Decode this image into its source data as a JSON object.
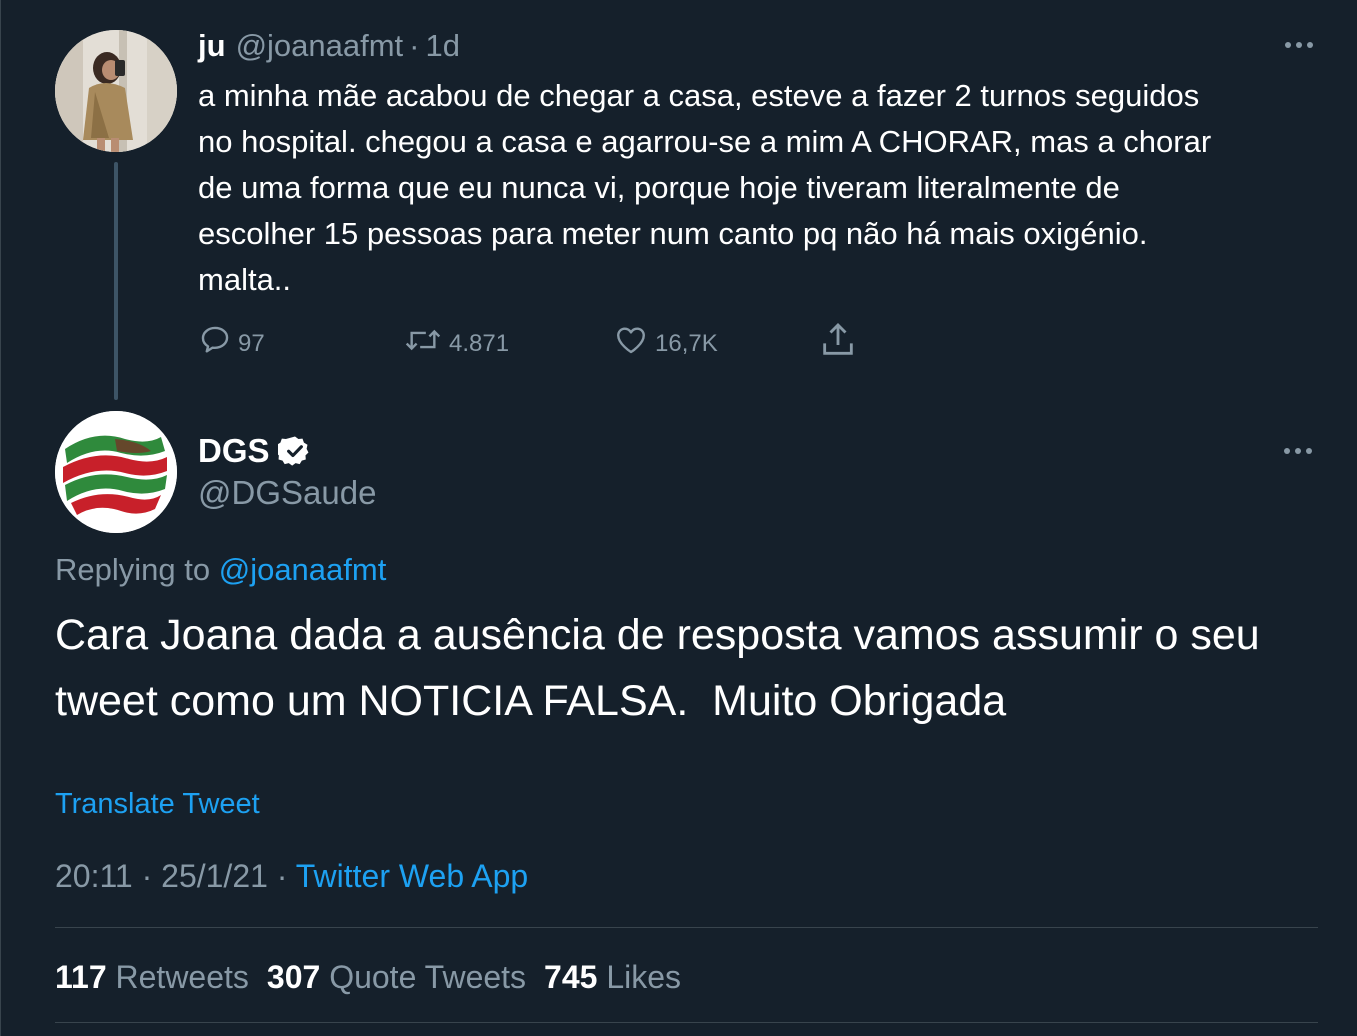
{
  "parent_tweet": {
    "name": "ju",
    "handle": "@joanaafmt",
    "separator": "·",
    "time": "1d",
    "text": "a minha mãe acabou de chegar a casa, esteve a fazer 2 turnos seguidos\nno hospital. chegou a casa e agarrou-se a mim A CHORAR, mas a chorar\nde uma forma que eu nunca vi, porque hoje tiveram literalmente de\nescolher 15 pessoas para meter num canto pq não há mais oxigénio.\nmalta..",
    "actions": {
      "reply_count": "97",
      "retweet_count": "4.871",
      "like_count": "16,7K"
    }
  },
  "reply_tweet": {
    "name": "DGS",
    "handle": "@DGSaude",
    "replying_label": "Replying to",
    "replying_to": "@joanaafmt",
    "text": "Cara Joana dada a ausência de resposta vamos assumir o seu tweet como um NOTICIA FALSA.  Muito Obrigada",
    "translate_label": "Translate Tweet",
    "time": "20:11",
    "date": "25/1/21",
    "separator": "·",
    "source": "Twitter Web App",
    "stats": {
      "retweets_count": "117",
      "retweets_label": "Retweets",
      "quote_count": "307",
      "quote_label": "Quote Tweets",
      "likes_count": "745",
      "likes_label": "Likes"
    }
  },
  "colors": {
    "background": "#15202b",
    "secondary_text": "#8899a6",
    "accent": "#1da1f2",
    "divider": "#38444d"
  },
  "icons": {
    "more": "more-horizontal-icon",
    "reply": "speech-bubble-icon",
    "retweet": "retweet-arrows-icon",
    "like": "heart-outline-icon",
    "share": "share-upload-icon",
    "verified": "verified-badge-icon"
  }
}
